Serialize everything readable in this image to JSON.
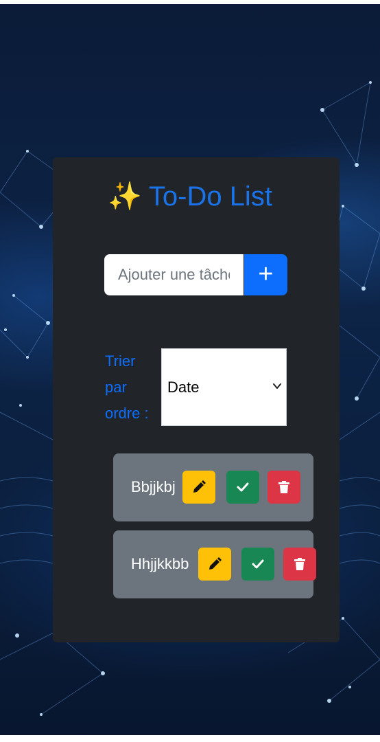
{
  "app": {
    "title_emoji": "✨",
    "title": "To-Do List"
  },
  "add_form": {
    "placeholder": "Ajouter une tâche",
    "add_button_label": "+"
  },
  "sort": {
    "label": "Trier par ordre :",
    "selected": "Date"
  },
  "tasks": [
    {
      "text": "Bbjjkbj",
      "actions": [
        "pencil-icon",
        "check-icon",
        "trash-icon"
      ]
    },
    {
      "text": "Hhjjkkbb",
      "actions": [
        "pencil-icon",
        "check-icon",
        "trash-icon"
      ]
    }
  ],
  "colors": {
    "accent": "#0d6efd",
    "card": "#212529",
    "task": "#6c757d",
    "edit": "#ffc107",
    "done": "#198754",
    "delete": "#dc3545"
  }
}
